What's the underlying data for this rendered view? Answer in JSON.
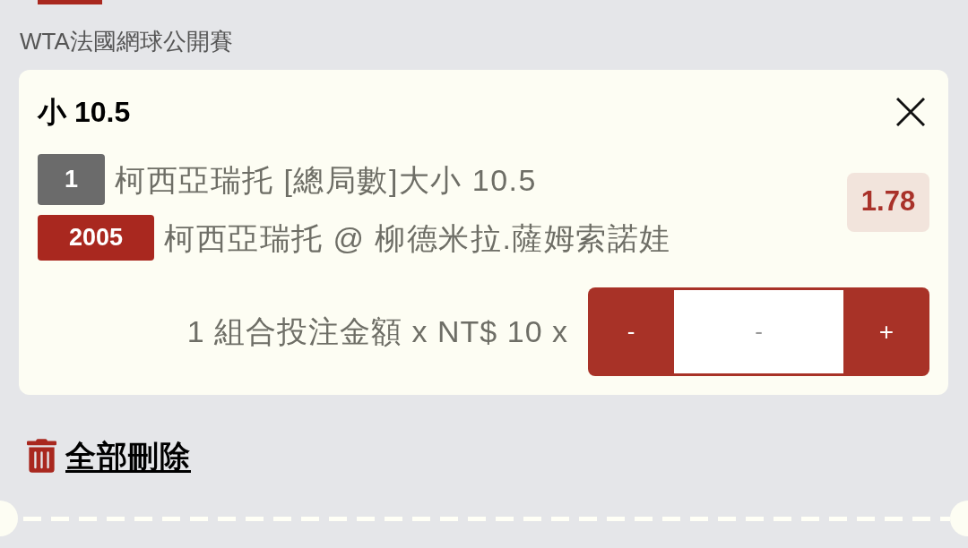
{
  "league": "WTA法國網球公開賽",
  "bet_card": {
    "title": "小 10.5",
    "lines": [
      {
        "kind": "market",
        "badge": "1",
        "text": "柯西亞瑞托 [總局數]大小 10.5"
      },
      {
        "kind": "match",
        "badge": "2005",
        "text": "柯西亞瑞托 @ 柳德米拉.薩姆索諾娃"
      }
    ],
    "odds": "1.78",
    "stake": {
      "label": "1 組合投注金額 x NT$ 10 x",
      "decrement": "-",
      "input": {
        "placeholder": "-"
      },
      "increment": "+"
    }
  },
  "delete_all": "全部刪除"
}
